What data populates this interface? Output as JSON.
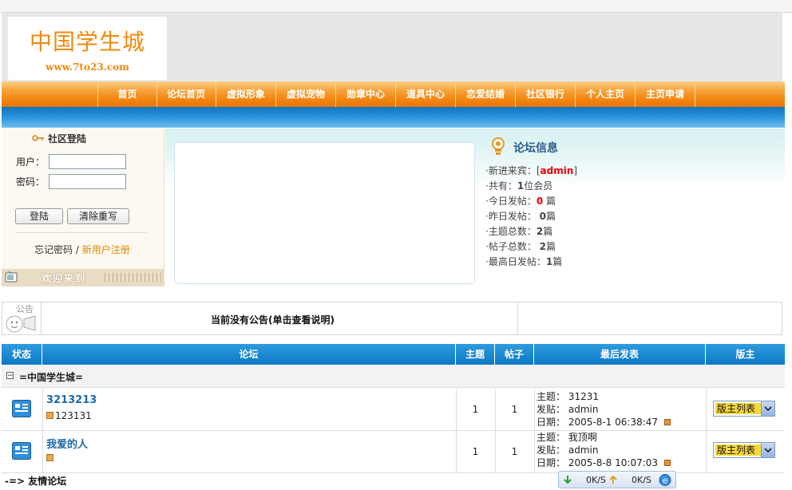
{
  "site": {
    "title": "中国学生城",
    "url": "www.7to23.com"
  },
  "nav": [
    "首页",
    "论坛首页",
    "虚拟形象",
    "虚拟宠物",
    "勋章中心",
    "道具中心",
    "恋爱结婚",
    "社区银行",
    "个人主页",
    "主页申请"
  ],
  "login": {
    "title": "社区登陆",
    "user_label": "用户：",
    "pass_label": "密码：",
    "login_button": "登陆",
    "reset_button": "清除重写",
    "forgot": "忘记密码",
    "sep": "/",
    "register": "新用户注册",
    "welcome": "欢迎来到"
  },
  "forum_info": {
    "title": "论坛信息",
    "newest_prefix": "·新进来宾：[",
    "newest_user": "admin",
    "newest_suffix": "]",
    "members_prefix": "·共有：",
    "members_count": "1",
    "members_suffix": "位会员",
    "today_prefix": "·今日发帖：",
    "today_count": "0",
    "today_suffix": "篇",
    "yesterday_prefix": "·昨日发帖：",
    "yesterday_count": "0",
    "yesterday_suffix": "篇",
    "topics_prefix": "·主题总数：",
    "topics_count": "2",
    "topics_suffix": "篇",
    "posts_prefix": "·帖子总数：",
    "posts_count": "2",
    "posts_suffix": "篇",
    "max_prefix": "·最高日发帖：",
    "max_count": "1",
    "max_suffix": "篇"
  },
  "announcement": {
    "icon_label": "公告",
    "text": "当前没有公告(单击查看说明)"
  },
  "table": {
    "headers": [
      "状态",
      "论坛",
      "主题",
      "帖子",
      "最后发表",
      "版主"
    ],
    "category": "=中国学生城=",
    "rows": [
      {
        "name": "3213213",
        "desc": "123131",
        "topics": "1",
        "posts": "1",
        "last_topic_label": "主题：",
        "last_topic": "31231",
        "last_author_label": "发贴：",
        "last_author": "admin",
        "last_date_label": "日期：",
        "last_date": "2005-8-1 06:38:47",
        "moderator": "版主列表"
      },
      {
        "name": "我爱的人",
        "desc": "",
        "topics": "1",
        "posts": "1",
        "last_topic_label": "主题：",
        "last_topic": "我顶啊",
        "last_author_label": "发贴：",
        "last_author": "admin",
        "last_date_label": "日期：",
        "last_date": "2005-8-8 10:07:03",
        "moderator": "版主列表"
      }
    ],
    "friend_links": "-=> 友情论坛"
  },
  "tray": {
    "down_speed": "0K/S",
    "up_speed": "0K/S"
  },
  "colors": {
    "orange": "#f28611",
    "blue": "#0a78c4",
    "link": "#1e6aa8",
    "accent_red": "#e00000"
  }
}
